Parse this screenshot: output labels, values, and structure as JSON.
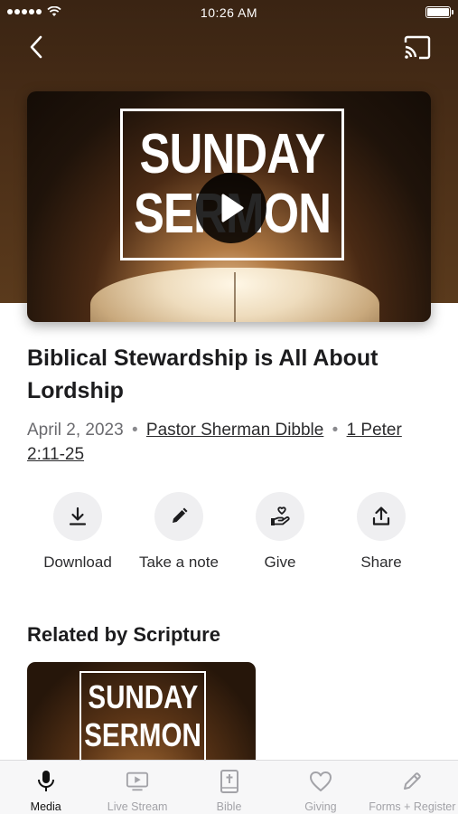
{
  "status_bar": {
    "time": "10:26 AM"
  },
  "video": {
    "thumbnail_lines": [
      "SUNDAY",
      "SERMON"
    ]
  },
  "sermon": {
    "title": "Biblical Stewardship is All About Lordship",
    "date": "April 2, 2023",
    "separator": "•",
    "speaker": "Pastor Sherman Dibble",
    "scripture": "1 Peter 2:11-25"
  },
  "actions": [
    {
      "label": "Download",
      "icon": "download-icon"
    },
    {
      "label": "Take a note",
      "icon": "pencil-icon"
    },
    {
      "label": "Give",
      "icon": "hand-heart-icon"
    },
    {
      "label": "Share",
      "icon": "share-icon"
    }
  ],
  "related": {
    "heading": "Related by Scripture",
    "card_lines": [
      "SUNDAY",
      "SERMON"
    ]
  },
  "tabs": [
    {
      "label": "Media",
      "icon": "microphone-icon",
      "active": true
    },
    {
      "label": "Live Stream",
      "icon": "tv-play-icon",
      "active": false
    },
    {
      "label": "Bible",
      "icon": "bible-icon",
      "active": false
    },
    {
      "label": "Giving",
      "icon": "heart-icon",
      "active": false
    },
    {
      "label": "Forms + Register",
      "icon": "pencil-icon",
      "active": false
    }
  ],
  "colors": {
    "hero_background": "#4a2e17",
    "active_tab": "#111111",
    "inactive_tab": "#a3a3a8",
    "action_circle": "#efeff1"
  }
}
